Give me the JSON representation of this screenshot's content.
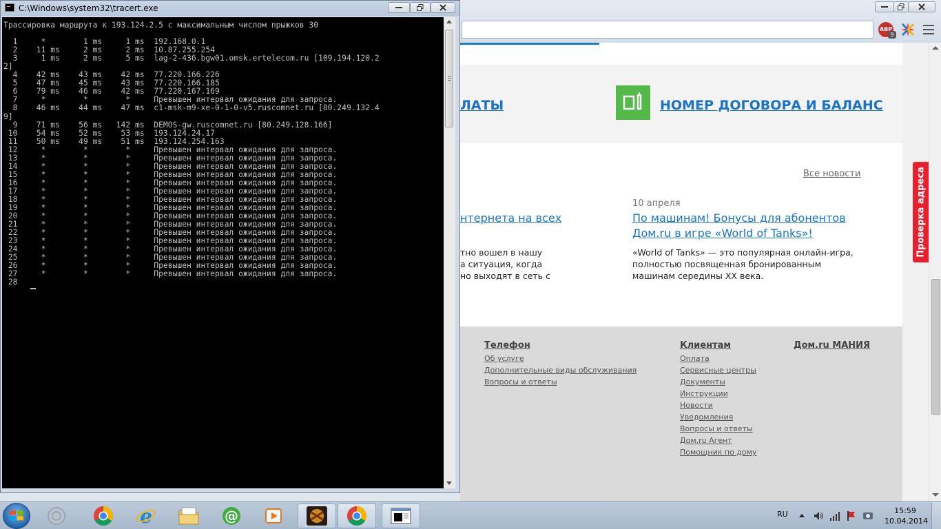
{
  "console": {
    "title": "C:\\Windows\\system32\\tracert.exe",
    "output": "Трассировка маршрута к 193.124.2.5 с максимальным числом прыжков 30\n\n  1     *        1 ms     1 ms  192.168.0.1\n  2    11 ms     2 ms     2 ms  10.87.255.254\n  3     1 ms     2 ms     5 ms  lag-2-436.bgw01.omsk.ertelecom.ru [109.194.120.2\n2]\n  4    42 ms    43 ms    42 ms  77.220.166.226\n  5    47 ms    45 ms    43 ms  77.220.166.185\n  6    79 ms    46 ms    42 ms  77.220.167.169\n  7     *        *        *     Превышен интервал ожидания для запроса.\n  8    46 ms    44 ms    47 ms  c1-msk-m9-xe-0-1-0-v5.ruscomnet.ru [80.249.132.4\n9]\n  9    71 ms    56 ms   142 ms  DEMOS-gw.ruscomnet.ru [80.249.128.166]\n 10    54 ms    52 ms    53 ms  193.124.24.17\n 11    50 ms    49 ms    51 ms  193.124.254.163\n 12     *        *        *     Превышен интервал ожидания для запроса.\n 13     *        *        *     Превышен интервал ожидания для запроса.\n 14     *        *        *     Превышен интервал ожидания для запроса.\n 15     *        *        *     Превышен интервал ожидания для запроса.\n 16     *        *        *     Превышен интервал ожидания для запроса.\n 17     *        *        *     Превышен интервал ожидания для запроса.\n 18     *        *        *     Превышен интервал ожидания для запроса.\n 19     *        *        *     Превышен интервал ожидания для запроса.\n 20     *        *        *     Превышен интервал ожидания для запроса.\n 21     *        *        *     Превышен интервал ожидания для запроса.\n 22     *        *        *     Превышен интервал ожидания для запроса.\n 23     *        *        *     Превышен интервал ожидания для запроса.\n 24     *        *        *     Превышен интервал ожидания для запроса.\n 25     *        *        *     Превышен интервал ожидания для запроса.\n 26     *        *        *     Превышен интервал ожидания для запроса.\n 27     *        *        *     Превышен интервал ожидания для запроса.\n 28",
    "text_color": "#c0c0c0",
    "bg_color": "#000000"
  },
  "browser": {
    "adblock": {
      "label": "ABP",
      "count": "9"
    },
    "features": {
      "payment_partial": "ЛАТЫ",
      "contract_balance": "НОМЕР ДОГОВОРА И БАЛАНС"
    },
    "news": {
      "all_news": "Все новости",
      "left": {
        "title_line1": "нтернета на всех",
        "body_line1": "тно вошел в нашу",
        "body_line2": "а ситуация, когда",
        "body_line3": "но выходят в сеть с"
      },
      "right": {
        "date": "10 апреля",
        "title_line1": "По машинам! Бонусы для абонентов",
        "title_line2": "Дом.ru в игре «World of Tanks»!",
        "body_line1": "«World of Tanks» — это популярная онлайн-игра,",
        "body_line2": "полностью посвященная бронированным",
        "body_line3": "машинам середины XX века."
      }
    },
    "footer": {
      "phone": {
        "heading": "Телефон",
        "links": [
          "Об услуге",
          "Дополнительные виды обслуживания",
          "Вопросы и ответы"
        ]
      },
      "clients": {
        "heading": "Клиентам",
        "links": [
          "Оплата",
          "Сервисные центры",
          "Документы",
          "Инструкции",
          "Новости",
          "Уведомления",
          "Вопросы и ответы",
          "Дом.ru Агент",
          "Помощник по дому"
        ]
      },
      "mania": {
        "heading": "Дом.ru МАНИЯ"
      }
    },
    "address_check_tab": "Проверка адреса",
    "accent_blue": "#1973c8",
    "accent_green": "#54b948",
    "accent_red": "#e8202d"
  },
  "taskbar": {
    "language": "RU",
    "time": "15:59",
    "date": "10.04.2014",
    "apps": [
      "start-orb",
      "disabled-app",
      "chrome",
      "internet-explorer",
      "file-explorer",
      "mail-agent",
      "media-player",
      "game-app",
      "chrome-active",
      "console-active"
    ]
  }
}
